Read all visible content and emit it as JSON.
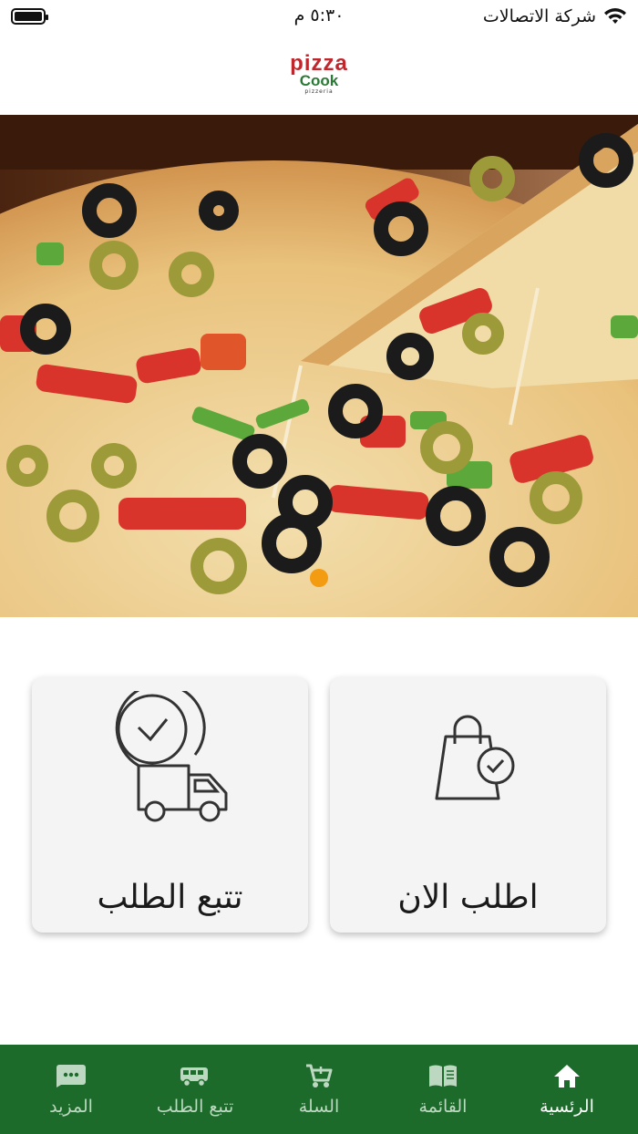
{
  "status_bar": {
    "carrier": "شركة الاتصالات",
    "time": "٥:٣٠ م",
    "battery_level": 1.0
  },
  "header": {
    "logo_line1": "pizza",
    "logo_line2": "Cook",
    "logo_line3": "pizzeria"
  },
  "banner": {
    "slide_count": 1,
    "active_slide": 1,
    "indicator_color": "#f39c12"
  },
  "actions": {
    "order_now_label": "اطلب الان",
    "order_now_icon": "shopping-bag-check-icon",
    "track_order_label": "تتبع الطلب",
    "track_order_icon": "clock-delivery-truck-icon"
  },
  "bottom_nav": {
    "color": "#1d6b2b",
    "items": [
      {
        "label": "الرئسية",
        "icon": "home-icon",
        "active": true
      },
      {
        "label": "القائمة",
        "icon": "menu-book-icon",
        "active": false
      },
      {
        "label": "السلة",
        "icon": "cart-icon",
        "active": false
      },
      {
        "label": "تتبع الطلب",
        "icon": "truck-icon",
        "active": false
      },
      {
        "label": "المزيد",
        "icon": "more-chat-icon",
        "active": false
      }
    ]
  }
}
